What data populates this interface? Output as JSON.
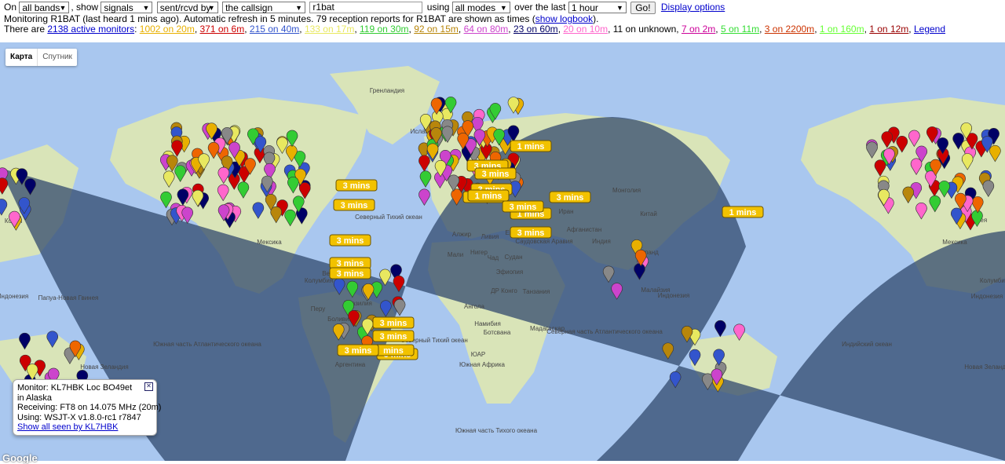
{
  "controls": {
    "on_label": "On",
    "band_select": "all bands",
    "show_label": ", show",
    "show_select": "signals",
    "direction_select": "sent/rcvd by",
    "target_select": "the callsign",
    "callsign_value": "r1bat",
    "using_label": "using",
    "mode_select": "all modes",
    "over_label": "over the last",
    "period_select": "1 hour",
    "go_button": "Go!",
    "display_options_link": "Display options"
  },
  "status": {
    "text": "Monitoring R1BAT (last heard 1 mins ago). Automatic refresh in 5 minutes. 79 reception reports for R1BAT are shown as times (",
    "logbook_link": "show logbook",
    "text_end": ")."
  },
  "monitors": {
    "prefix": "There are ",
    "active_link": "2138 active monitors",
    "colon": ": ",
    "bands": [
      {
        "label": "1002 on 20m",
        "color": "#e8b000"
      },
      {
        "label": "371 on 6m",
        "color": "#cc0000"
      },
      {
        "label": "215 on 40m",
        "color": "#3355cc"
      },
      {
        "label": "133 on 17m",
        "color": "#e8e860"
      },
      {
        "label": "119 on 30m",
        "color": "#33cc33"
      },
      {
        "label": "92 on 15m",
        "color": "#b8860b"
      },
      {
        "label": "64 on 80m",
        "color": "#cc44cc"
      },
      {
        "label": "23 on 60m",
        "color": "#000066"
      },
      {
        "label": "20 on 10m",
        "color": "#ff66cc"
      }
    ],
    "unknown": "11 on unknown",
    "bands2": [
      {
        "label": "7 on 2m",
        "color": "#cc0099"
      },
      {
        "label": "5 on 11m",
        "color": "#33dd33"
      },
      {
        "label": "3 on 2200m",
        "color": "#cc3300"
      },
      {
        "label": "1 on 160m",
        "color": "#66ff33"
      },
      {
        "label": "1 on 12m",
        "color": "#990000"
      }
    ],
    "legend_link": "Legend"
  },
  "map": {
    "type_map": "Карта",
    "type_satellite": "Спутник",
    "ocean_color": "#a9c7ef",
    "land_color": "#d9e4b8",
    "night_color": "#314a6e",
    "place_labels": [
      {
        "text": "Гренландия"
      },
      {
        "text": "Исландия"
      },
      {
        "text": "Монголия"
      },
      {
        "text": "Китай"
      },
      {
        "text": "Мексика"
      },
      {
        "text": "Мексика"
      },
      {
        "text": "Колумбия"
      },
      {
        "text": "Колумбия"
      },
      {
        "text": "Венесуэла"
      },
      {
        "text": "Перу"
      },
      {
        "text": "Бразилия"
      },
      {
        "text": "Боливия"
      },
      {
        "text": "Аргентина"
      },
      {
        "text": "Алжир"
      },
      {
        "text": "Ливия"
      },
      {
        "text": "Египет"
      },
      {
        "text": "Мали"
      },
      {
        "text": "Нигер"
      },
      {
        "text": "Чад"
      },
      {
        "text": "Судан"
      },
      {
        "text": "Эфиопия"
      },
      {
        "text": "ДР Конго"
      },
      {
        "text": "Танзания"
      },
      {
        "text": "Ангола"
      },
      {
        "text": "Намибия"
      },
      {
        "text": "Ботсвана"
      },
      {
        "text": "Мадагаскар"
      },
      {
        "text": "ЮАР"
      },
      {
        "text": "Южная Африка"
      },
      {
        "text": "Саудовская Аравия"
      },
      {
        "text": "Иран"
      },
      {
        "text": "Афганистан"
      },
      {
        "text": "Индия"
      },
      {
        "text": "Таиланд"
      },
      {
        "text": "Малайзия"
      },
      {
        "text": "Индонезия"
      },
      {
        "text": "Индонезия"
      },
      {
        "text": "Индонезия"
      },
      {
        "text": "Папуа-Новая Гвинея"
      },
      {
        "text": "Новая Зеландия"
      },
      {
        "text": "Новая Зеландия"
      },
      {
        "text": "Корея"
      },
      {
        "text": "Корея"
      },
      {
        "text": "Северный Тихий океан"
      },
      {
        "text": "Северный Тихий океан"
      },
      {
        "text": "Северная часть Атлантического океана"
      },
      {
        "text": "Южная часть Атлантического океана"
      },
      {
        "text": "Индийский океан"
      },
      {
        "text": "Южная часть Тихого океана"
      },
      {
        "text": "Южная часть Тихого океана"
      },
      {
        "text": "Южный океан"
      }
    ],
    "time_labels": [
      {
        "text": "1 mins"
      },
      {
        "text": "3 mins"
      },
      {
        "text": "3 mins"
      },
      {
        "text": "3 mins"
      },
      {
        "text": "1 mins"
      },
      {
        "text": "3 mins"
      },
      {
        "text": "3 mins"
      },
      {
        "text": "3 mins"
      },
      {
        "text": "1 mins"
      },
      {
        "text": "3 mins"
      },
      {
        "text": "3 mins"
      },
      {
        "text": "3 mins"
      },
      {
        "text": "1 mins"
      },
      {
        "text": "3 mins"
      },
      {
        "text": "3 mins"
      },
      {
        "text": "3 mins"
      },
      {
        "text": "3 mins"
      },
      {
        "text": "3 mins"
      },
      {
        "text": "3 mins"
      },
      {
        "text": "mins"
      },
      {
        "text": "1 mins"
      },
      {
        "text": "3 mins"
      }
    ],
    "pin_colors": [
      "#e8b000",
      "#cc0000",
      "#3355cc",
      "#e8e860",
      "#33cc33",
      "#b8860b",
      "#cc44cc",
      "#ff66cc",
      "#ee6600",
      "#000066",
      "#888888"
    ]
  },
  "infowindow": {
    "monitor": "Monitor: KL7HBK Loc BO49et",
    "location": "in Alaska",
    "receiving": "Receiving: FT8 on 14.075 MHz (20m)",
    "using": "Using: WSJT-X v1.8.0-rc1 r7847",
    "link": "Show all seen by KL7HBK",
    "close_icon": "close-icon"
  },
  "google_logo": "Google"
}
